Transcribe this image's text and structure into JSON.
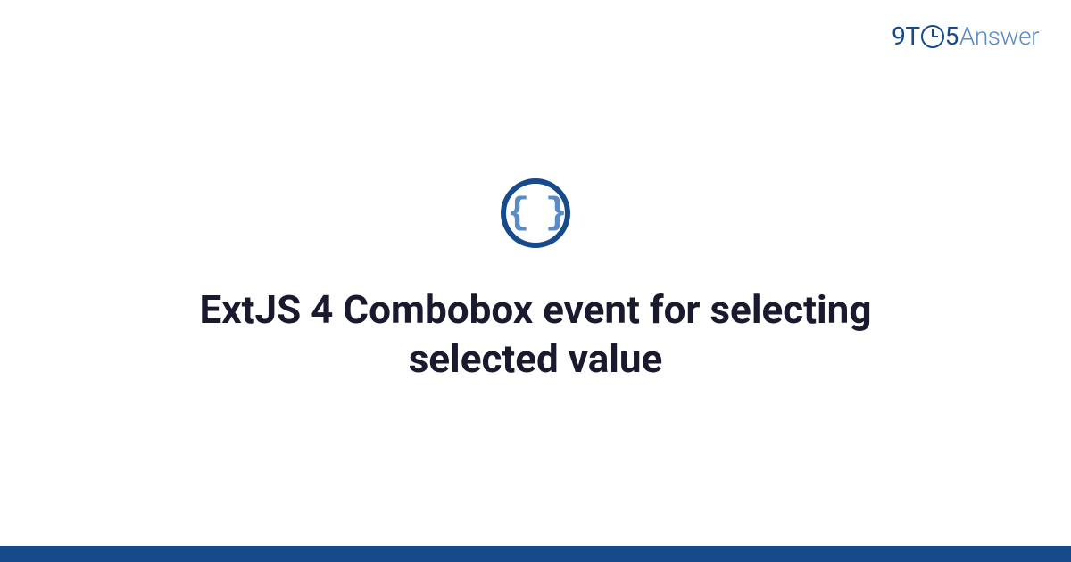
{
  "logo": {
    "part1": "9",
    "part2": "T",
    "part3": "5",
    "part4": "Answer"
  },
  "icon": {
    "glyph": "{ }"
  },
  "title": "ExtJS 4 Combobox event for selecting selected value",
  "colors": {
    "primary": "#174a8b",
    "secondary": "#5a8bc4",
    "text": "#1a1a2e"
  }
}
